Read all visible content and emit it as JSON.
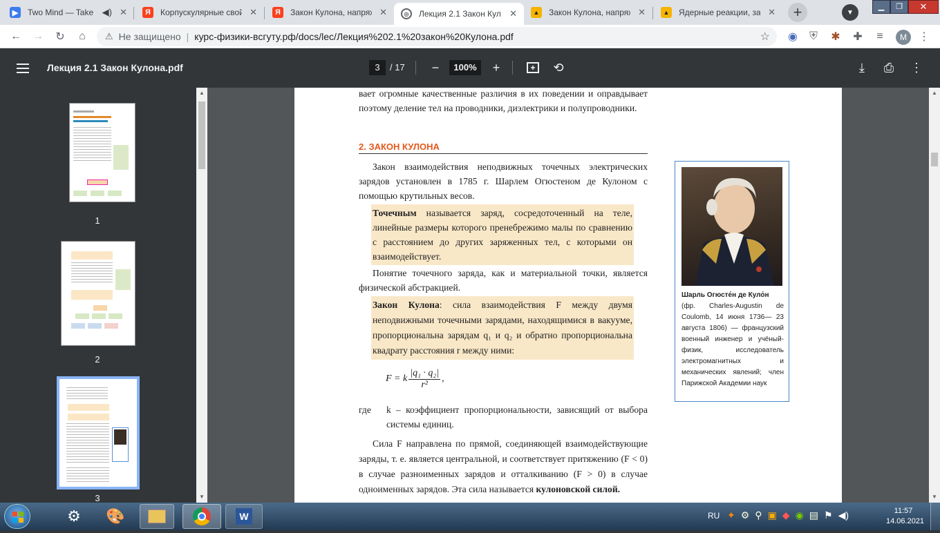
{
  "tabs": [
    {
      "title": "Two Mind — Take",
      "favicon_color": "#3c7bf0",
      "active": false
    },
    {
      "title": "Корпускулярные свой",
      "favicon_color": "#fc3f1d",
      "active": false
    },
    {
      "title": "Закон Кулона, напряж",
      "favicon_color": "#fc3f1d",
      "active": false
    },
    {
      "title": "Лекция 2.1 Закон Кулс",
      "favicon_color": "#5f6368",
      "active": true
    },
    {
      "title": "Закон Кулона, напряж",
      "favicon_color": "#f5b400",
      "active": false
    },
    {
      "title": "Ядерные реакции, зак",
      "favicon_color": "#f5b400",
      "active": false
    }
  ],
  "toolbar": {
    "security_label": "Не защищено",
    "url": "курс-физики-всгуту.рф/docs/lec/Лекция%202.1%20закон%20Кулона.pdf",
    "profile_letter": "M"
  },
  "pdf": {
    "filename": "Лекция 2.1 Закон Кулона.pdf",
    "page_current": "3",
    "page_total": "/ 17",
    "zoom": "100%"
  },
  "thumbnails": [
    {
      "label": "1"
    },
    {
      "label": "2"
    },
    {
      "label": "3"
    }
  ],
  "document": {
    "intro": "вает огромные качественные различия в их поведении и оправдывает поэтому деление тел на проводники, диэлектрики и полупроводники.",
    "heading": "2. ЗАКОН КУЛОНА",
    "para1": "Закон взаимодействия неподвижных точечных электрических зарядов установлен в 1785 г. Шарлем Огюстеном де Кулоном с помощью крутильных весов.",
    "def_bold": "Точечным",
    "def_rest": " называется заряд, сосредоточенный на теле, линейные размеры которого пренебрежимо малы по сравнению с расстоянием до других заряженных тел, с которыми он взаимодействует.",
    "para2": "Понятие точечного заряда, как и материальной точки, является физической абстракцией.",
    "law_bold": "Закон Кулона",
    "law_rest": ": сила взаимодействия F между двумя неподвижными точечными зарядами, находящимися в вакууме, пропорциональна зарядам q₁ и q₂ и обратно пропорциональна квадрату расстояния r между ними:",
    "formula_lhs": "F = k",
    "formula_num": "|q₁ · q₂|",
    "formula_den": "r²",
    "formula_tail": ",",
    "where_label": "где",
    "where_text": "k – коэффициент пропорциональности, зависящий от выбора системы единиц.",
    "para3_a": "Сила F направлена по прямой, соединяющей взаимодействующие заряды, т. е. является центральной, и соответствует притяжению (F < 0) в случае разноименных зарядов и отталкиванию (F > 0) в случае одноименных зарядов. Эта сила называется ",
    "para3_bold": "кулоновской силой.",
    "caption_bold": "Шарль Огюсте́н де Куло́н",
    "caption_rest": "(фр. Charles-Augustin de Coulomb, 14 июня 1736— 23 августа 1806) — французский военный инженер и учёный-физик, исследователь электромагнитных и механических явлений; член Парижской Академии наук"
  },
  "taskbar": {
    "lang": "RU",
    "time": "11:57",
    "date": "14.06.2021"
  }
}
